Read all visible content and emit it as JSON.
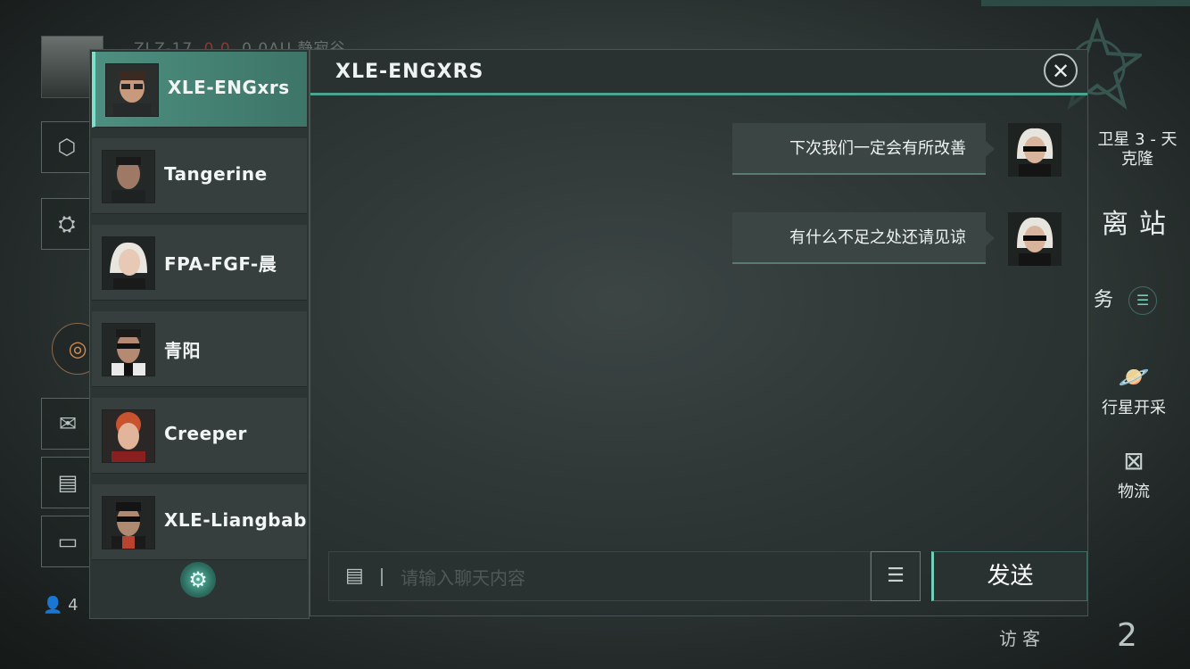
{
  "hud": {
    "top_status": "ZLZ-17",
    "security": "0.0",
    "distance": "0.0AU",
    "system": "静寂谷",
    "satellite": "卫星 3 - 天\n克隆",
    "undock_label": "离站",
    "mission_label": "务",
    "mining_label": "行星开采",
    "logistics_label": "物流",
    "visitor_label": "访客",
    "visitor_count": "2",
    "bottom_count": "4"
  },
  "contacts": [
    {
      "name": "XLE-ENGxrs",
      "active": true
    },
    {
      "name": "Tangerine",
      "active": false
    },
    {
      "name": "FPA-FGF-晨",
      "active": false
    },
    {
      "name": "青阳",
      "active": false
    },
    {
      "name": "Creeper",
      "active": false
    },
    {
      "name": "XLE-Liangbab",
      "active": false
    }
  ],
  "chat": {
    "title": "XLE-ENGXRS",
    "messages": [
      {
        "text": "下次我们一定会有所改善",
        "sender": "self"
      },
      {
        "text": "有什么不足之处还请见谅",
        "sender": "self"
      }
    ],
    "input_placeholder": "请输入聊天内容",
    "send_label": "发送"
  },
  "icons": {
    "close": "close-icon",
    "settings": "gear-icon",
    "keyboard": "keyboard-icon",
    "menu": "menu-icon"
  },
  "colors": {
    "accent": "#4aa58f",
    "active_contact": "#4d8f80",
    "security_red": "#d04a3a"
  }
}
